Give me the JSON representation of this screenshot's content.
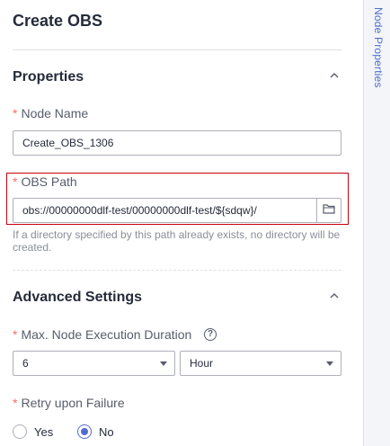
{
  "panel": {
    "title": "Create OBS"
  },
  "side_tab": {
    "label": "Node Properties"
  },
  "properties": {
    "section_title": "Properties",
    "node_name": {
      "required_mark": "*",
      "label": "Node Name",
      "value": "Create_OBS_1306"
    },
    "obs_path": {
      "required_mark": "*",
      "label": "OBS Path",
      "value": "obs://00000000dlf-test/00000000dlf-test/${sdqw}/",
      "hint_line1": "If a directory specified by this path already exists, no directory will be",
      "hint_line2": "created.",
      "folder_icon": "folder-icon"
    }
  },
  "advanced": {
    "section_title": "Advanced Settings",
    "max_duration": {
      "required_mark": "*",
      "label": "Max. Node Execution Duration",
      "help_glyph": "?",
      "value": "6",
      "unit": "Hour"
    },
    "retry": {
      "required_mark": "*",
      "label": "Retry upon Failure",
      "options": [
        {
          "label": "Yes",
          "selected": false
        },
        {
          "label": "No",
          "selected": true
        }
      ]
    }
  },
  "colors": {
    "accent": "#526ecc",
    "required": "#f66f6a",
    "highlight_border": "#c7000b"
  }
}
